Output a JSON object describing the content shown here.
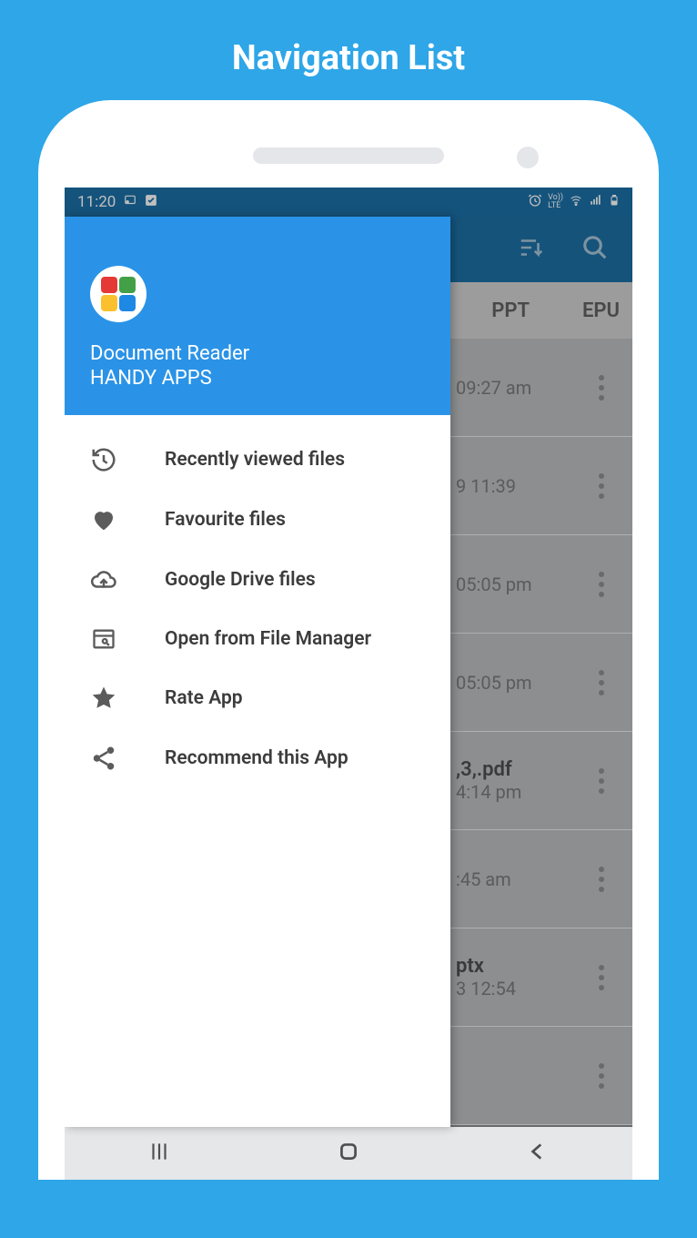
{
  "page": {
    "title": "Navigation List"
  },
  "statusbar": {
    "time": "11:20"
  },
  "tabs": {
    "ppt": "PPT",
    "epub": "EPU"
  },
  "drawer": {
    "app_name": "Document Reader",
    "publisher": "HANDY APPS",
    "logo_colors": {
      "a": "#e53935",
      "b": "#43a047",
      "c": "#fbc02d",
      "d": "#1e88e5"
    },
    "items": [
      {
        "icon": "history-icon",
        "label": "Recently viewed files"
      },
      {
        "icon": "heart-icon",
        "label": "Favourite files"
      },
      {
        "icon": "cloud-upload-icon",
        "label": "Google Drive files"
      },
      {
        "icon": "window-icon",
        "label": "Open from File Manager"
      },
      {
        "icon": "star-icon",
        "label": "Rate App"
      },
      {
        "icon": "share-icon",
        "label": "Recommend this App"
      }
    ]
  },
  "files": [
    {
      "title_fragment": "",
      "meta_fragment": "09:27 am"
    },
    {
      "title_fragment": "",
      "meta_fragment": "9 11:39"
    },
    {
      "title_fragment": "",
      "meta_fragment": "05:05 pm"
    },
    {
      "title_fragment": "",
      "meta_fragment": "05:05 pm"
    },
    {
      "title_fragment": ",3,.pdf",
      "meta_fragment": "4:14 pm"
    },
    {
      "title_fragment": "",
      "meta_fragment": ":45 am"
    },
    {
      "title_fragment": "ptx",
      "meta_fragment": "3 12:54"
    },
    {
      "title_fragment": "",
      "meta_fragment": ""
    }
  ]
}
